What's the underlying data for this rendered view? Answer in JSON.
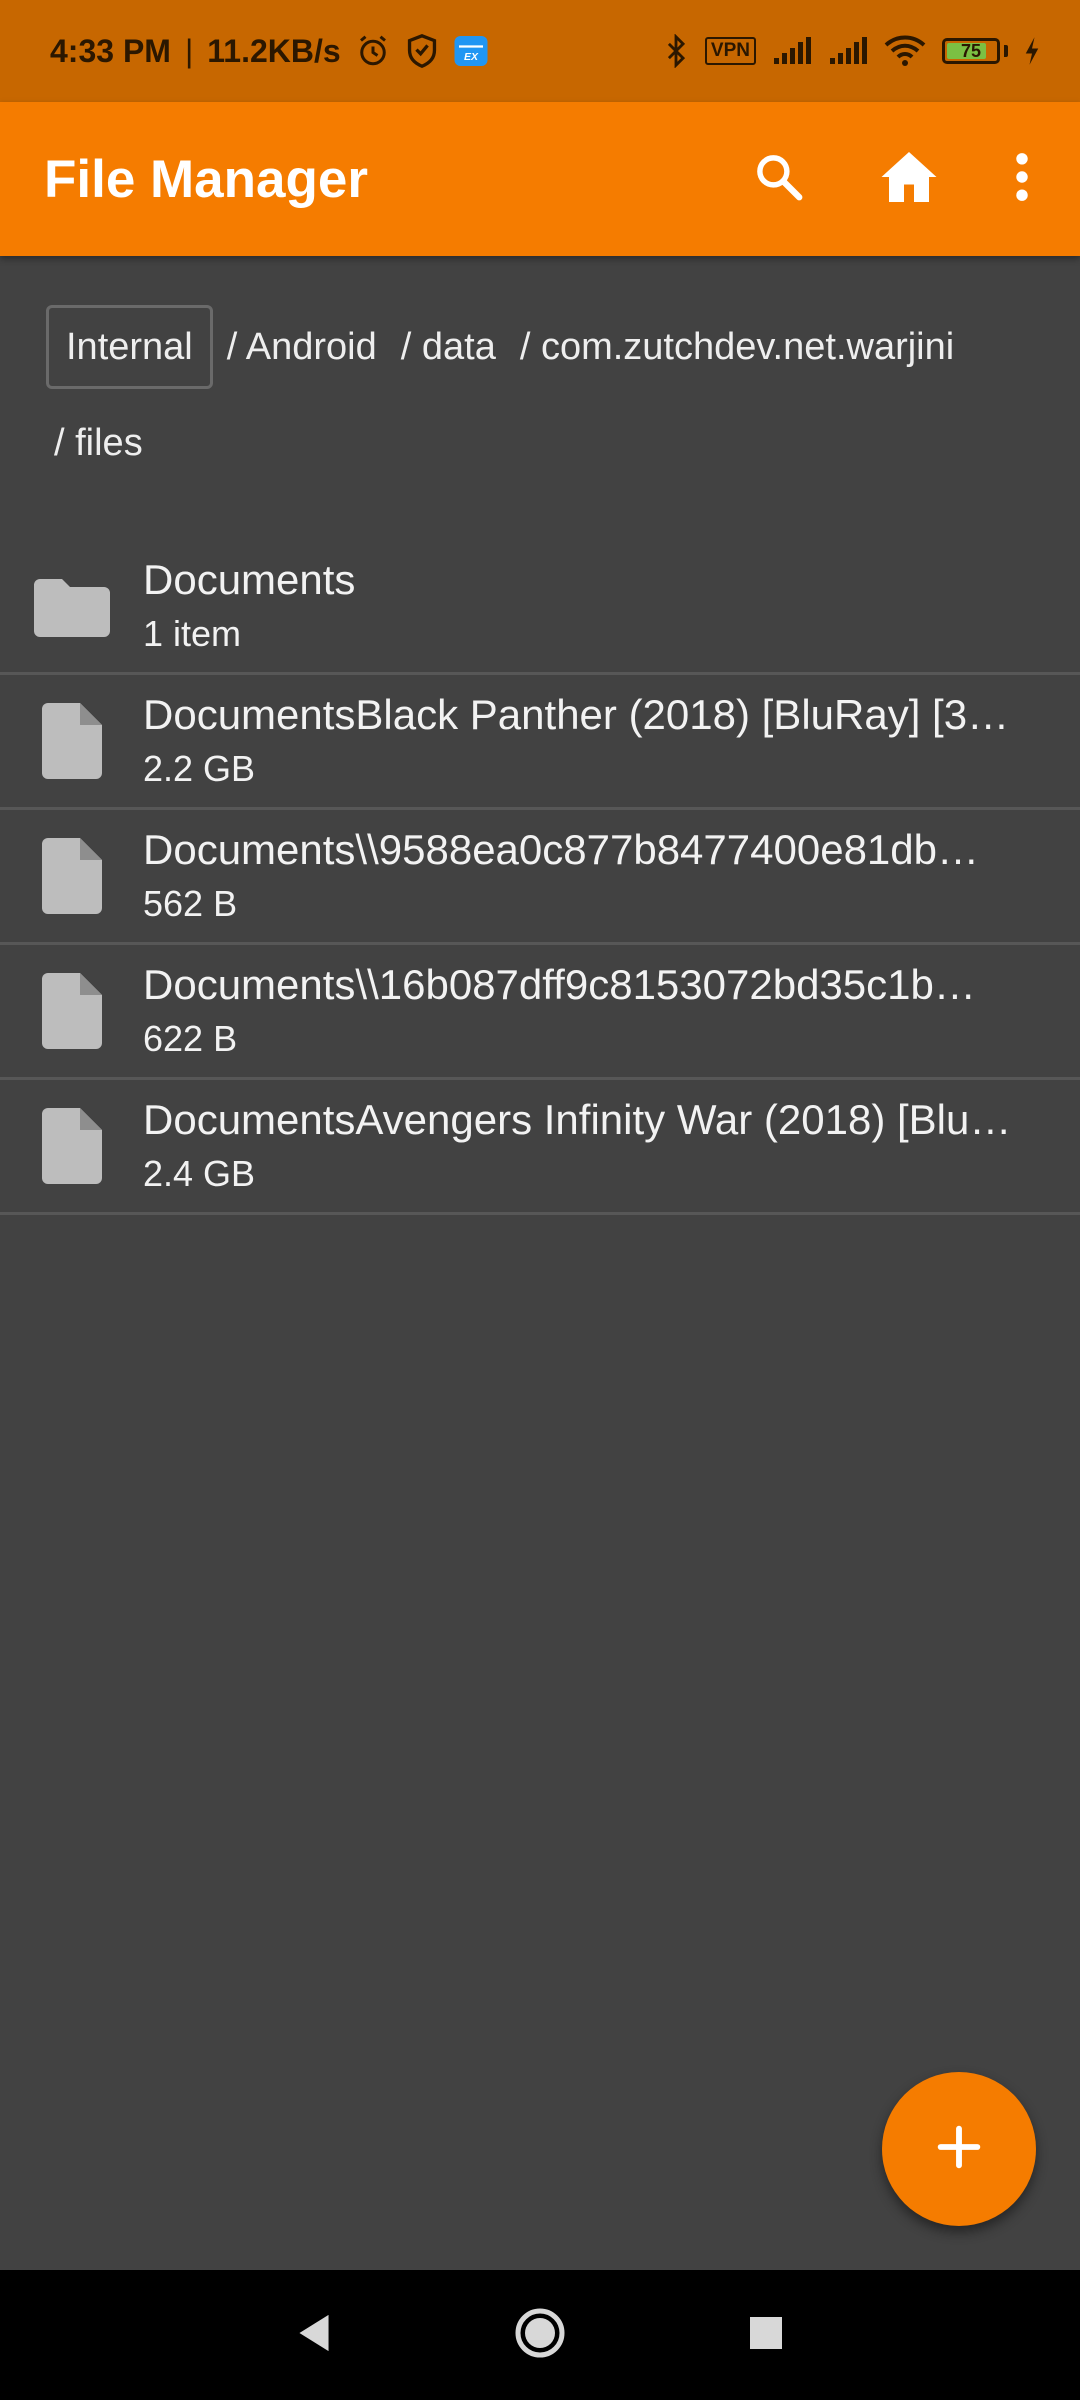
{
  "status_bar": {
    "time": "4:33 PM",
    "separator": "|",
    "speed": "11.2KB/s",
    "vpn": "VPN",
    "battery": "75"
  },
  "app_bar": {
    "title": "File Manager",
    "actions": [
      "search-icon",
      "home-icon",
      "more-vert-icon"
    ]
  },
  "breadcrumb": {
    "root": "Internal",
    "segments": [
      "/ Android",
      "/ data",
      "/ com.zutchdev.net.warjini",
      "/ files"
    ]
  },
  "files": [
    {
      "icon": "folder-icon",
      "name": "Documents",
      "meta": "1 item"
    },
    {
      "icon": "file-icon",
      "name": "DocumentsBlack Panther (2018) [BluRay] [3…",
      "meta": "2.2 GB"
    },
    {
      "icon": "file-icon",
      "name": "Documents\\\\9588ea0c877b8477400e81db…",
      "meta": "562 B"
    },
    {
      "icon": "file-icon",
      "name": "Documents\\\\16b087dff9c8153072bd35c1b…",
      "meta": "622 B"
    },
    {
      "icon": "file-icon",
      "name": "DocumentsAvengers Infinity War (2018) [Blu…",
      "meta": "2.4 GB"
    }
  ],
  "fab": {
    "icon": "add-icon"
  },
  "nav_bar": {
    "buttons": [
      "back-icon",
      "home-circle-icon",
      "recents-icon"
    ]
  },
  "colors": {
    "status_bar": "#C76700",
    "app_bar": "#F57C00",
    "background": "#424242",
    "fab": "#F57C00",
    "icon_gray": "#BDBDBD"
  }
}
